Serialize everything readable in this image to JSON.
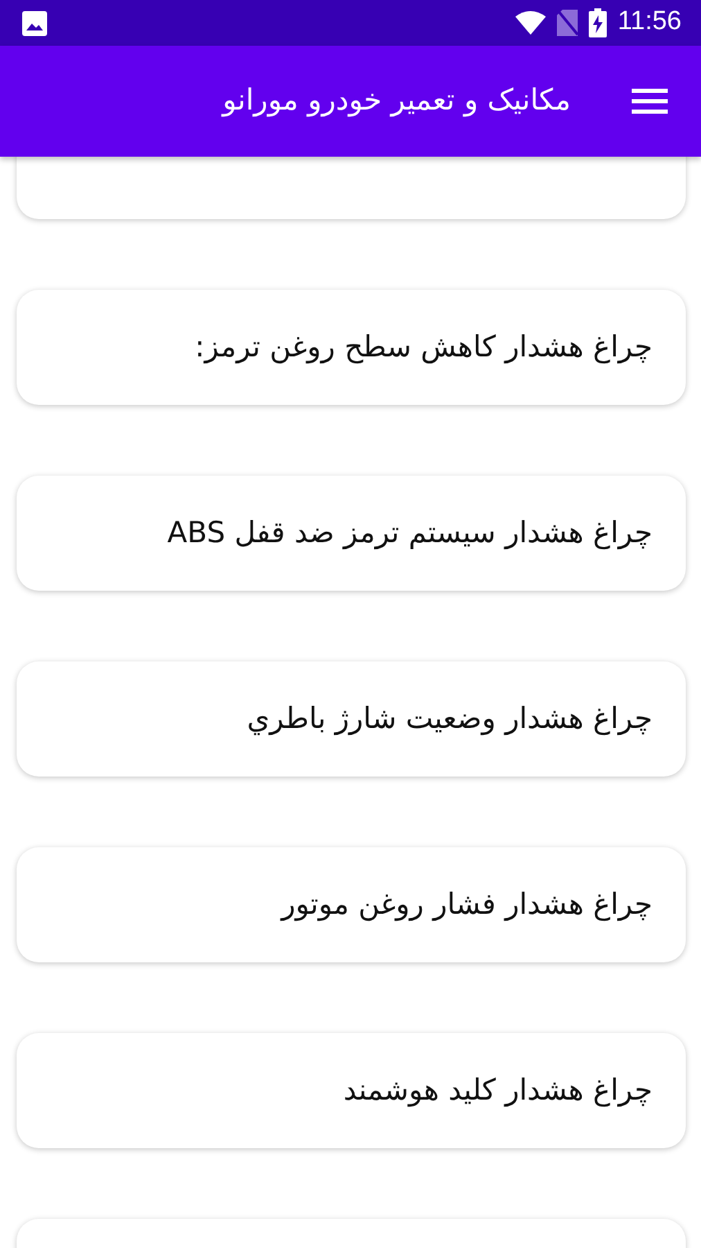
{
  "status_bar": {
    "time": "11:56"
  },
  "app_bar": {
    "title": "مکانیک و تعمیر خودرو مورانو"
  },
  "cards": [
    {
      "kind": "cut"
    },
    {
      "kind": "card",
      "title": "چراغ هشدار کاهش سطح روغن ترمز:"
    },
    {
      "kind": "card",
      "title": "چراغ هشدار سیستم ترمز ضد قفل ABS"
    },
    {
      "kind": "card",
      "title": "چراغ هشدار وضعیت شارژ باطري"
    },
    {
      "kind": "card",
      "title": "چراغ هشدار فشار روغن موتور"
    },
    {
      "kind": "card",
      "title": "چراغ هشدار کلید هوشمند"
    },
    {
      "kind": "cut"
    }
  ]
}
